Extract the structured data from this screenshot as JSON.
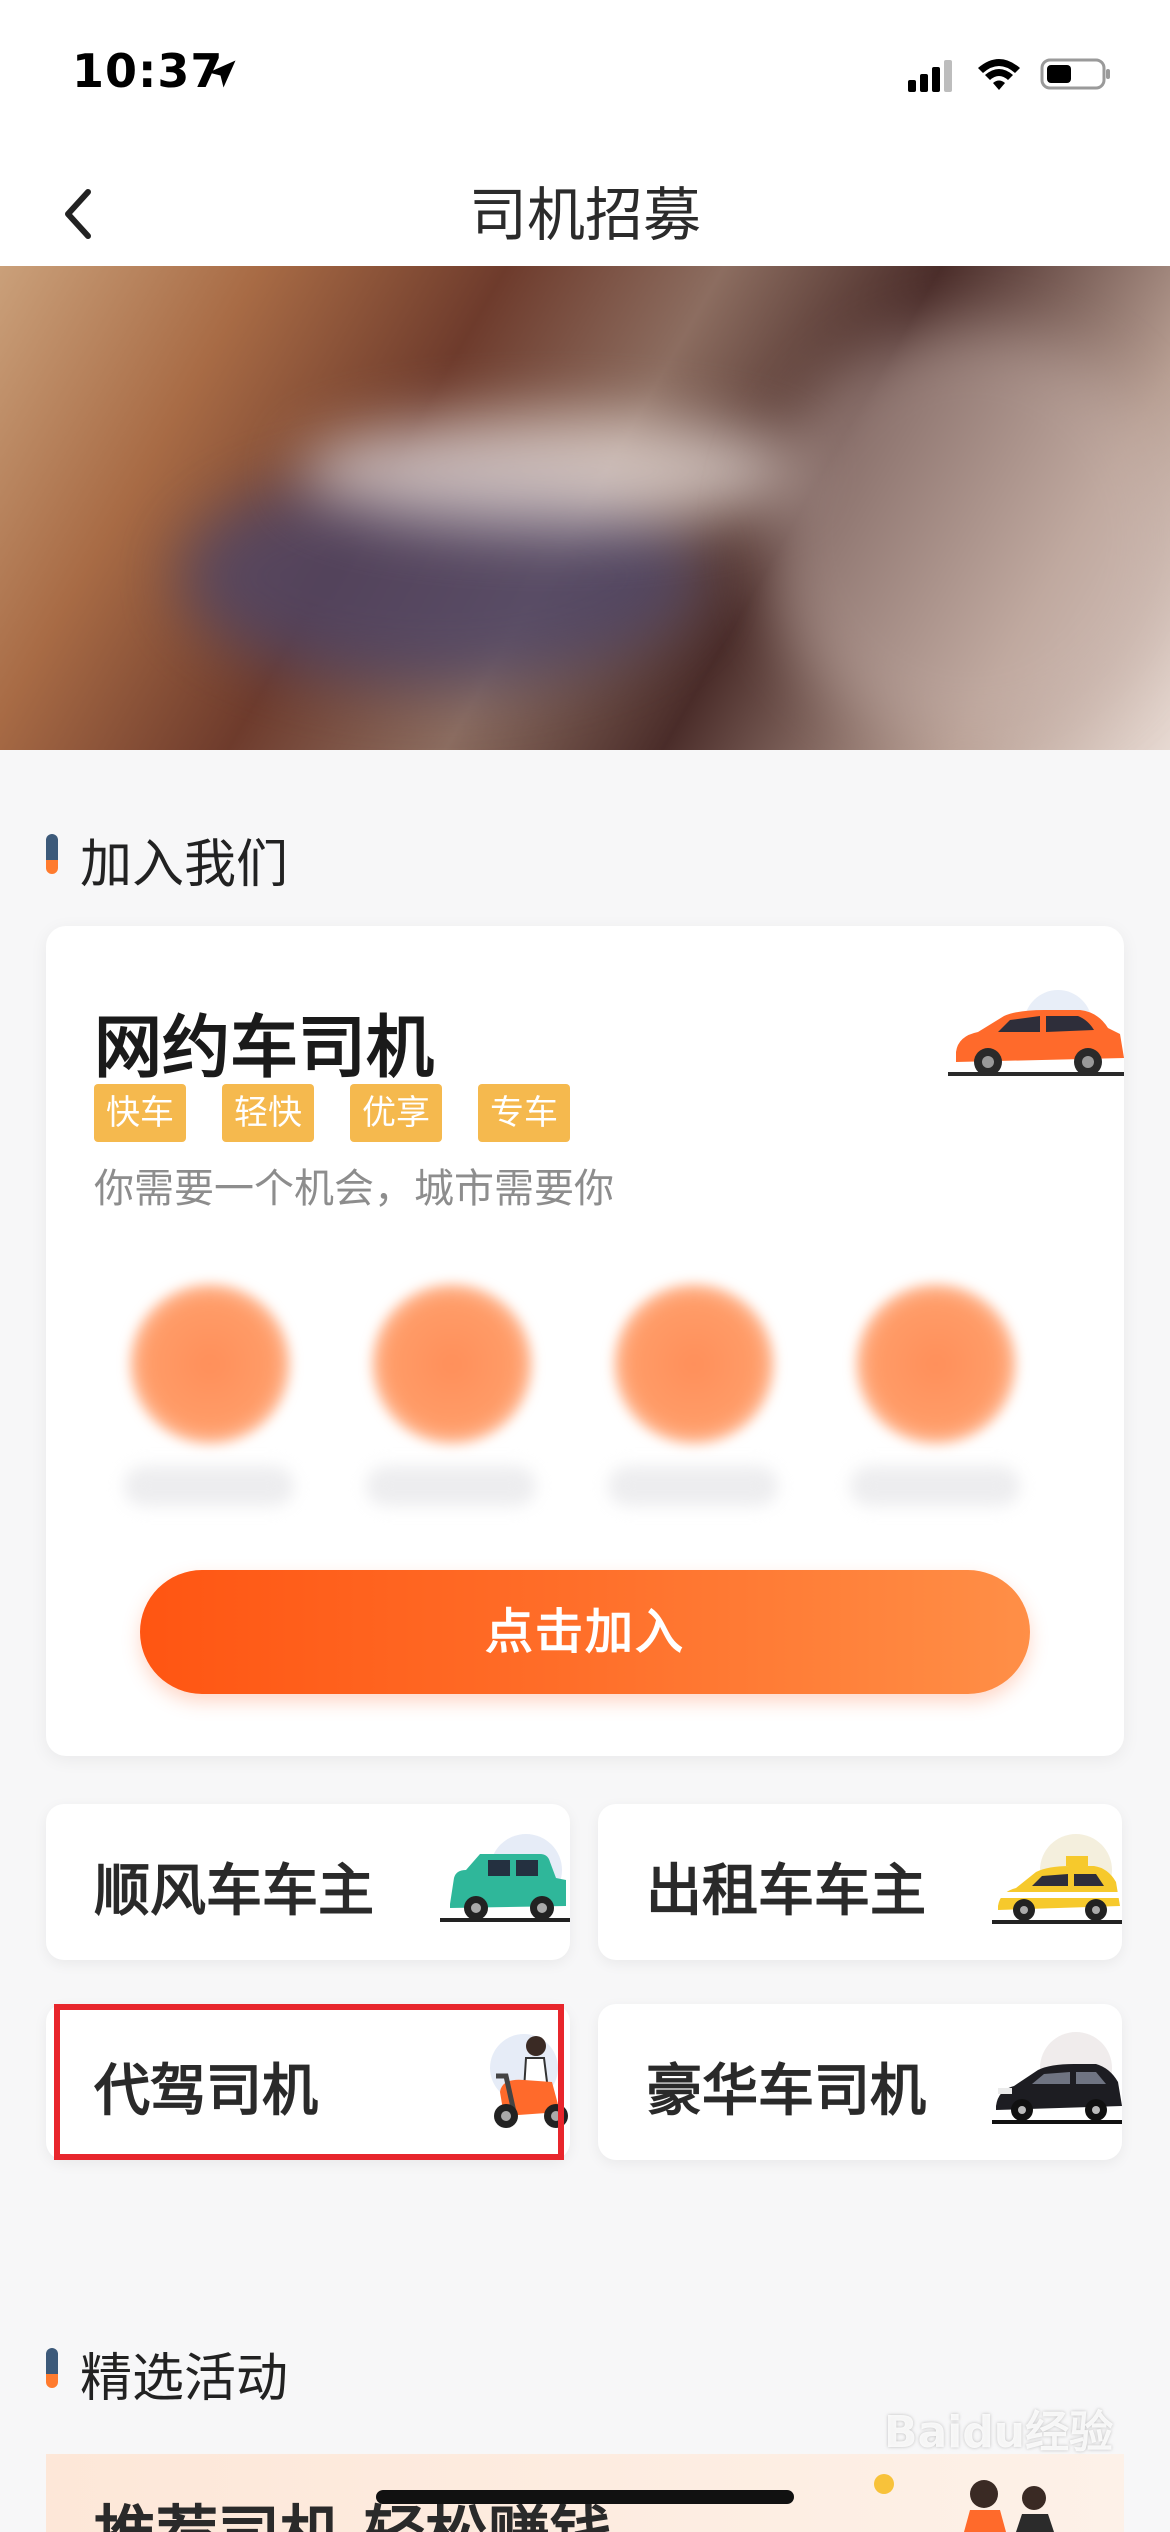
{
  "status_bar": {
    "time": "10:37"
  },
  "nav": {
    "title": "司机招募"
  },
  "join_section": {
    "title": "加入我们",
    "card": {
      "title": "网约车司机",
      "tags": [
        "快车",
        "轻快",
        "优享",
        "专车"
      ],
      "subtitle": "你需要一个机会，城市需要你",
      "button_label": "点击加入"
    }
  },
  "driver_types": [
    {
      "label": "顺风车车主",
      "icon": "suv-icon"
    },
    {
      "label": "出租车车主",
      "icon": "taxi-icon"
    },
    {
      "label": "代驾司机",
      "icon": "scooter-rider-icon",
      "highlighted": true
    },
    {
      "label": "豪华车司机",
      "icon": "luxury-car-icon"
    }
  ],
  "activities_section": {
    "title": "精选活动",
    "promo_title": "推荐司机 轻松赚钱"
  },
  "watermark": "Baidu经验",
  "colors": {
    "accent_orange": "#ff5512",
    "tag_yellow": "#f5b94e",
    "highlight_red": "#e8262c"
  }
}
